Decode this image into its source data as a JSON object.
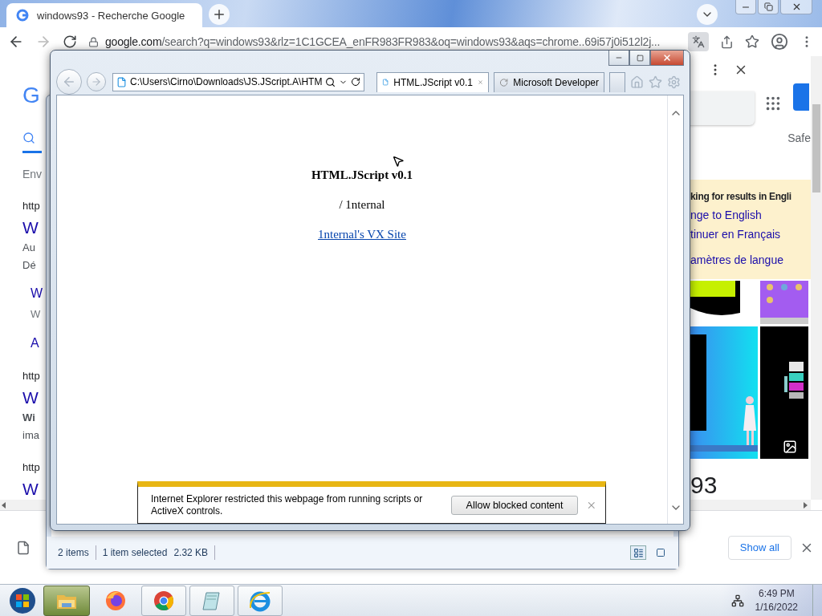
{
  "chrome": {
    "tabs": [
      {
        "title": "windows93 - Recherche Google",
        "selected": true
      }
    ],
    "address": {
      "host": "google.com",
      "path": "/search?q=windows93&rlz=1C1GCEA_enFR983FR983&oq=windows93&aqs=chrome..69i57j0i512l2j..."
    }
  },
  "google": {
    "left_fragments": [
      {
        "kind": "logo",
        "text": "G"
      },
      {
        "kind": "stats",
        "text": "Env"
      },
      {
        "kind": "url",
        "text": "http"
      },
      {
        "kind": "title",
        "text": "W"
      },
      {
        "kind": "snippet",
        "text": "Au"
      },
      {
        "kind": "snippet",
        "text": "Dé"
      },
      {
        "kind": "sitelink",
        "text": "W"
      },
      {
        "kind": "sitedesc",
        "text": "W"
      },
      {
        "kind": "sitelink",
        "text": "A"
      },
      {
        "kind": "url",
        "text": "http"
      },
      {
        "kind": "title",
        "text": "W"
      },
      {
        "kind": "bold",
        "text": "Wi"
      },
      {
        "kind": "snippet",
        "text": "ima"
      },
      {
        "kind": "url",
        "text": "http"
      },
      {
        "kind": "title",
        "text": "W"
      }
    ],
    "safe": "Safe",
    "language_notice": {
      "heading": "king for results in Engli",
      "links": [
        "nge to English",
        "tinuer en Français",
        "amètres de langue"
      ]
    },
    "count_fragment": "93",
    "show_all": "Show all"
  },
  "explorer": {
    "status": [
      "2 items",
      "1 item selected",
      "2.32 KB"
    ]
  },
  "ie": {
    "address": "C:\\Users\\Cirno\\Downloads\\JS.JScript.A\\HTM",
    "tabs": [
      {
        "title": "HTML.JScript v0.1",
        "selected": true,
        "loading": false
      },
      {
        "title": "Microsoft Developer",
        "selected": false,
        "loading": true
      }
    ],
    "page": {
      "heading": "HTML.JScript v0.1",
      "byline": "/ 1nternal",
      "link": "1nternal's VX Site"
    },
    "notification": {
      "message": "Internet Explorer restricted this webpage from running scripts or ActiveX controls.",
      "button": "Allow blocked content"
    }
  },
  "taskbar": {
    "apps": [
      {
        "kind": "explorer",
        "selected": true,
        "running": true
      },
      {
        "kind": "firefox",
        "selected": false,
        "running": false
      },
      {
        "kind": "chrome",
        "selected": false,
        "running": true
      },
      {
        "kind": "notepad",
        "selected": false,
        "running": true
      },
      {
        "kind": "ie",
        "selected": false,
        "running": true
      }
    ],
    "time": "6:49 PM",
    "date": "1/16/2022"
  }
}
